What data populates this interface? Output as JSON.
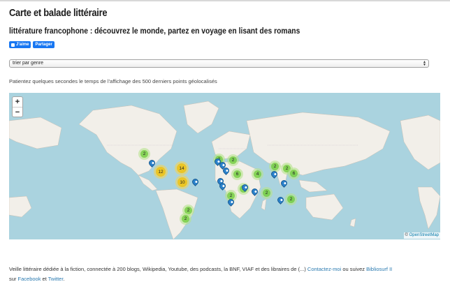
{
  "header": {
    "title": "Carte et balade littéraire",
    "subtitle": "littérature francophone : découvrez le monde, partez en voyage en lisant des romans"
  },
  "social": {
    "like_label": "J'aime",
    "share_label": "Partager",
    "color": "#1877f2"
  },
  "sort_select": {
    "selected": "trier par genre"
  },
  "info_text": "Patientez quelques secondes le temps de l'affichage des 500 derniers points géolocalisés",
  "map": {
    "zoom_in": "+",
    "zoom_out": "−",
    "attribution_prefix": "© ",
    "attribution_link": "OpenStreetMap",
    "water_color": "#aad3df",
    "land_color": "#f2efe9",
    "clusters": [
      {
        "count": "2",
        "color": "green"
      },
      {
        "count": "12",
        "color": "yellow"
      },
      {
        "count": "14",
        "color": "yellow"
      },
      {
        "count": "10",
        "color": "yellow"
      },
      {
        "count": "2",
        "color": "green"
      },
      {
        "count": "2",
        "color": "green"
      },
      {
        "count": "6",
        "color": "green"
      },
      {
        "count": "4",
        "color": "green"
      },
      {
        "count": "2",
        "color": "green"
      },
      {
        "count": "2",
        "color": "green"
      },
      {
        "count": "6",
        "color": "green"
      },
      {
        "count": "2",
        "color": "green"
      },
      {
        "count": "2",
        "color": "green"
      },
      {
        "count": "2",
        "color": "green"
      },
      {
        "count": "2",
        "color": "green"
      },
      {
        "count": "2",
        "color": "green"
      },
      {
        "count": "2",
        "color": "green"
      }
    ]
  },
  "footer": {
    "text_1": "Veille littéraire dédiée à la fiction, connectée à 200 blogs, Wikipedia, Youtube, des podcasts, la BNF, VIAF et des libraires de (...) ",
    "contact_link": "Contactez-moi",
    "text_2": " ou suivez ",
    "bibliosurf_link": "Bibliosurf II",
    "text_3": " sur ",
    "facebook_link": "Facebook",
    "text_4": " et ",
    "twitter_link": "Twitter",
    "text_5": "."
  }
}
